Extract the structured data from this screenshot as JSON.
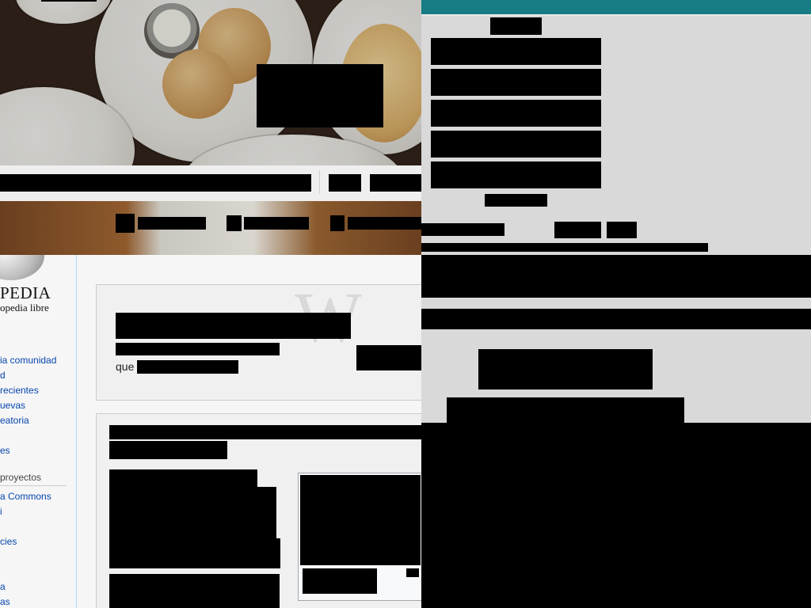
{
  "food_site": {
    "hero_badge": "",
    "search_bar_text": "",
    "search_button": "",
    "signin_button": "",
    "nav_items": [
      {
        "icon": "nav-icon",
        "label": ""
      },
      {
        "icon": "nav-icon",
        "label": ""
      },
      {
        "icon": "nav-icon",
        "label": ""
      }
    ]
  },
  "form_panel": {
    "accent_color": "#177c84",
    "header_label": "",
    "buttons": [
      "",
      "",
      "",
      "",
      ""
    ],
    "footer_label": "",
    "row_label": "",
    "row_buttons": [
      "",
      ""
    ],
    "row_link": ""
  },
  "wiki": {
    "logo_title": "PEDIA",
    "logo_subtitle": "opedia libre",
    "links_group1": [
      "ia comunidad",
      "d",
      "recientes",
      "uevas",
      "eatoria"
    ],
    "link_single": "es",
    "section_heading": "proyectos",
    "links_group2": [
      "a Commons",
      "i"
    ],
    "link_extra": "cies",
    "links_group3": [
      "a",
      "as"
    ],
    "welcome_prefix": "que",
    "link_color": "#0645ad"
  }
}
